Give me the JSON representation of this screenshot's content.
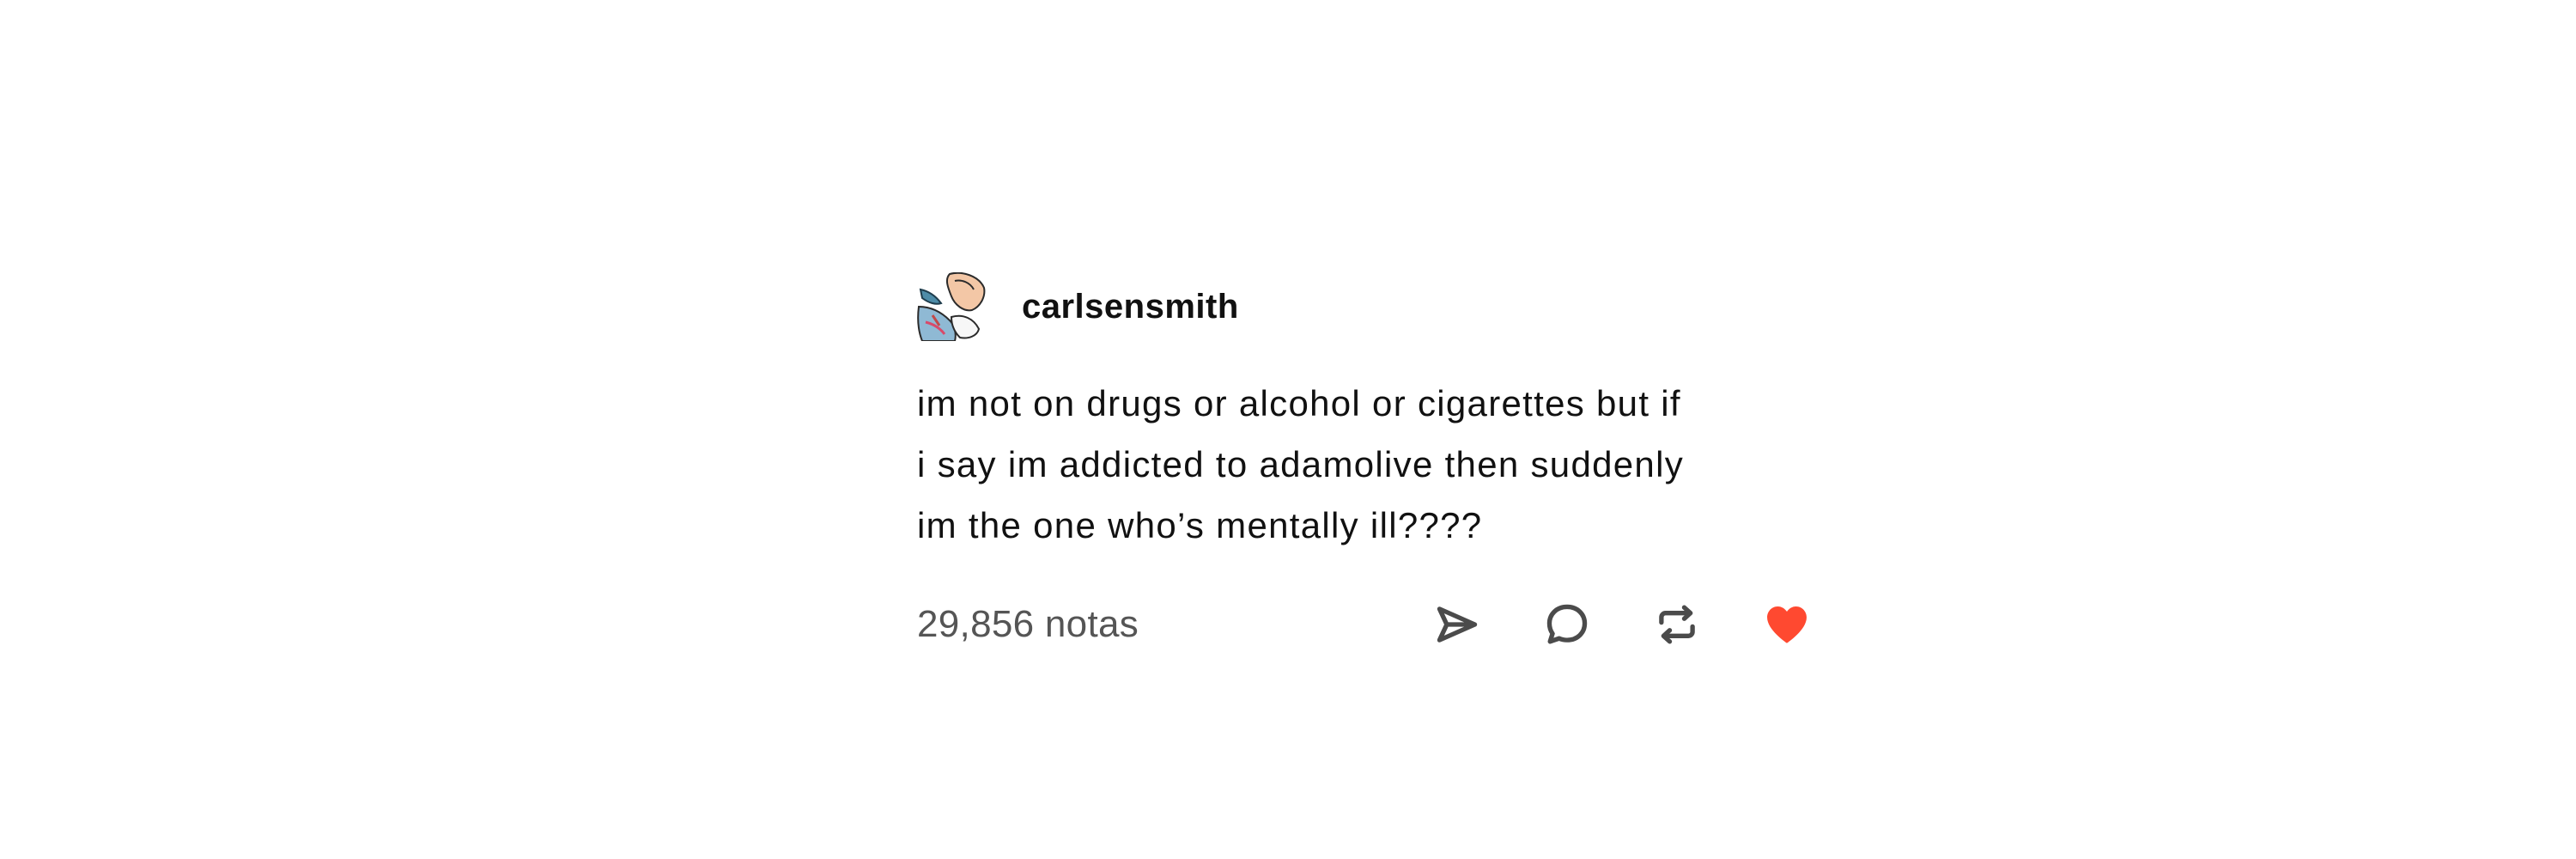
{
  "post": {
    "username": "carlsensmith",
    "avatar_icon": "avatar-illustration-icon",
    "body_lines": [
      "im not on drugs or alcohol or cigarettes but if",
      "i say im addicted to adamolive then suddenly",
      "im the one who’s mentally ill????"
    ],
    "notes_label": "29,856 notas",
    "actions": {
      "share_icon": "send-icon",
      "reply_icon": "chat-bubble-icon",
      "reblog_icon": "reblog-icon",
      "like_icon": "heart-icon"
    }
  },
  "colors": {
    "background": "#ffffff",
    "text": "#111111",
    "notes_text": "#555555",
    "icon_stroke": "#4b4b4b",
    "heart": "#ff4930"
  }
}
